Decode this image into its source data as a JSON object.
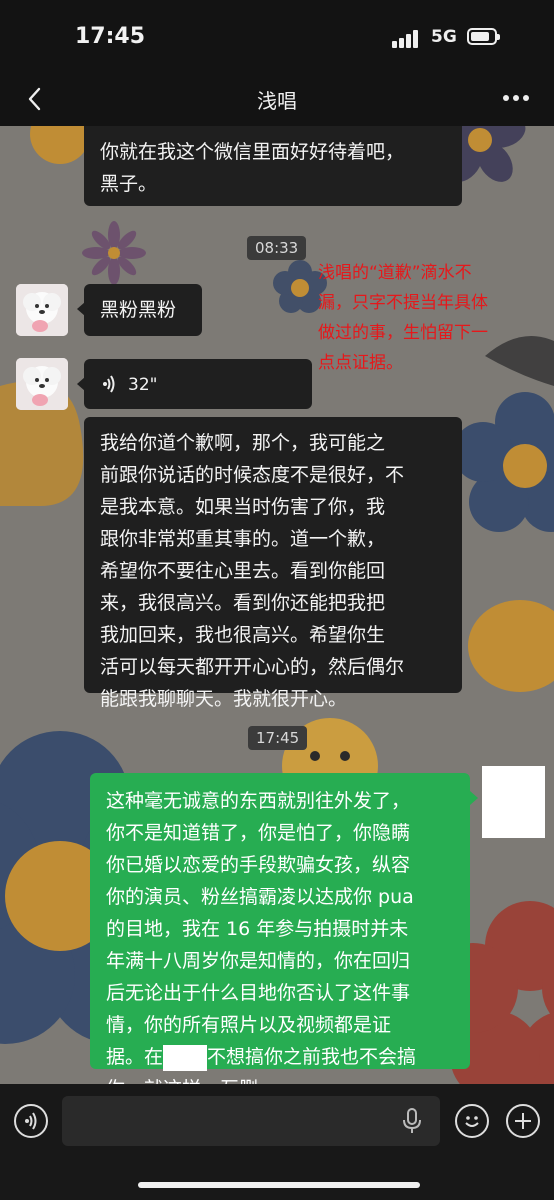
{
  "status_bar": {
    "time": "17:45",
    "network": "5G",
    "icons": [
      "signal-icon",
      "battery-icon"
    ]
  },
  "nav": {
    "title": "浅唱",
    "back_icon": "chevron-left-icon",
    "more_icon": "more-dots-icon"
  },
  "messages": [
    {
      "type": "text",
      "sender": "contact",
      "text": "你就在我这个微信里面好好待着吧，\n黑子。"
    },
    {
      "type": "timestamp",
      "text": "08:33"
    },
    {
      "type": "text",
      "sender": "contact",
      "text": "黑粉黑粉"
    },
    {
      "type": "voice",
      "sender": "contact",
      "duration": "32\""
    },
    {
      "type": "text",
      "sender": "contact",
      "text": "我给你道个歉啊，那个，我可能之\n前跟你说话的时候态度不是很好，不\n是我本意。如果当时伤害了你，我\n跟你非常郑重其事的。道一个歉，\n希望你不要往心里去。看到你能回\n来，我很高兴。看到你还能把我把\n我加回来，我也很高兴。希望你生\n活可以每天都开开心心的，然后偶尔\n能跟我聊聊天。我就很开心。"
    },
    {
      "type": "timestamp",
      "text": "17:45"
    },
    {
      "type": "text",
      "sender": "self",
      "text_a": "这种毫无诚意的东西就别往外发了，\n你不是知道错了，你是怕了，你隐瞒\n你已婚以恋爱的手段欺骗女孩，纵容\n你的演员、粉丝搞霸凌以达成你 pua\n的目地，我在 16 年参与拍摄时并未\n年满十八周岁你是知情的，你在回归\n后无论出于什么目地你否认了这件事\n情，你的所有照片以及视频都是证\n据。在",
      "text_b": "不想搞你之前我也不会搞\n你，就这样，互删"
    }
  ],
  "annotation": "浅唱的“道歉”滴水不\n漏，只字不提当年具体\n做过的事，生怕留下一\n点点证据。",
  "input_bar": {
    "voice_toggle_icon": "voice-toggle-icon",
    "mic_icon": "microphone-icon",
    "emoji_icon": "emoji-icon",
    "add_icon": "plus-icon",
    "input_value": ""
  },
  "colors": {
    "self_bubble": "#27ad52",
    "contact_bubble": "#1f1f1f",
    "annotation": "#e6181b"
  }
}
